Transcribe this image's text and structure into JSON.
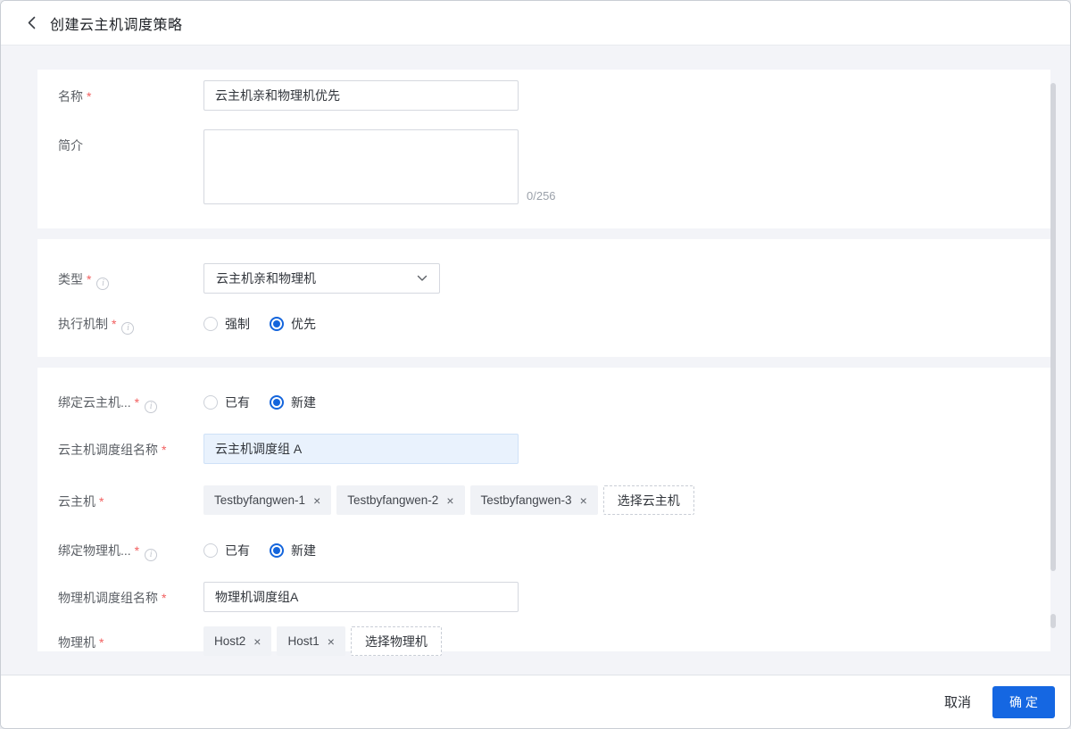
{
  "header": {
    "title": "创建云主机调度策略"
  },
  "icons": {
    "back": "chevron-left-icon",
    "info": "info-circle-icon",
    "dropdown": "chevron-down-icon",
    "remove": "×"
  },
  "colors": {
    "accent_blue": "#1567e2",
    "required_red": "#f25f5f",
    "page_background": "#f3f4f8",
    "highlight_input_bg": "#e9f2fd"
  },
  "sections": {
    "basic": {
      "name": {
        "label": "名称",
        "required": "*",
        "value": "云主机亲和物理机优先"
      },
      "description": {
        "label": "简介",
        "value": "",
        "counter": "0/256"
      }
    },
    "type": {
      "type": {
        "label": "类型",
        "required": "*",
        "value": "云主机亲和物理机"
      },
      "mechanism": {
        "label": "执行机制",
        "required": "*",
        "options": [
          "强制",
          "优先"
        ],
        "selected": "优先"
      }
    },
    "binding": {
      "vm_group_bind": {
        "label": "绑定云主机...",
        "required": "*",
        "options": [
          "已有",
          "新建"
        ],
        "selected": "新建"
      },
      "vm_group_name": {
        "label": "云主机调度组名称",
        "required": "*",
        "value": "云主机调度组 A"
      },
      "vms": {
        "label": "云主机",
        "required": "*",
        "tags": [
          "Testbyfangwen-1",
          "Testbyfangwen-2",
          "Testbyfangwen-3"
        ],
        "remove_icon": "×",
        "select_button": "选择云主机"
      },
      "host_group_bind": {
        "label": "绑定物理机...",
        "required": "*",
        "options": [
          "已有",
          "新建"
        ],
        "selected": "新建"
      },
      "host_group_name": {
        "label": "物理机调度组名称",
        "required": "*",
        "value": "物理机调度组A"
      },
      "hosts": {
        "label": "物理机",
        "required": "*",
        "tags": [
          "Host2",
          "Host1"
        ],
        "remove_icon": "×",
        "select_button": "选择物理机"
      }
    }
  },
  "footer": {
    "cancel": "取消",
    "confirm": "确 定"
  }
}
